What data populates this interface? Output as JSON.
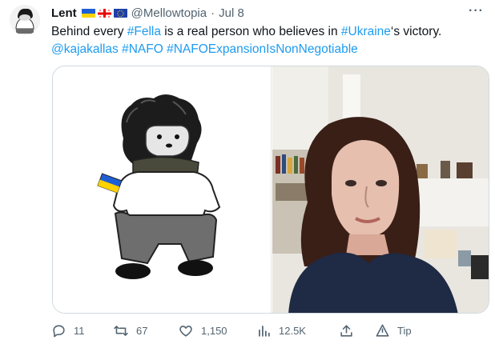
{
  "author": {
    "display_name": "Lent",
    "handle": "@Mellowtopia",
    "separator": "·",
    "date": "Jul 8",
    "flags": [
      "ukraine-flag",
      "georgia-flag",
      "eu-flag"
    ]
  },
  "menu_glyph": "···",
  "tweet": {
    "line1": {
      "pre": "Behind every ",
      "tag1": "#Fella",
      "mid": " is a real person who believes in ",
      "tag2": "#Ukraine",
      "post": "‘s victory."
    },
    "line2": {
      "mention": "@kajakallas",
      "tag3": "#NAFO",
      "tag4": "#NAFOExpansionIsNonNegotiable"
    }
  },
  "media": {
    "left_icon": "nafo-fella-dog-icon",
    "right_icon": "selfie-photo"
  },
  "actions": {
    "replies": "11",
    "retweets": "67",
    "likes": "1,150",
    "views": "12.5K",
    "tip": "Tip"
  },
  "colors": {
    "link": "#1d9bf0",
    "text": "#0f1419",
    "muted": "#536471",
    "border": "#cfd9de"
  }
}
